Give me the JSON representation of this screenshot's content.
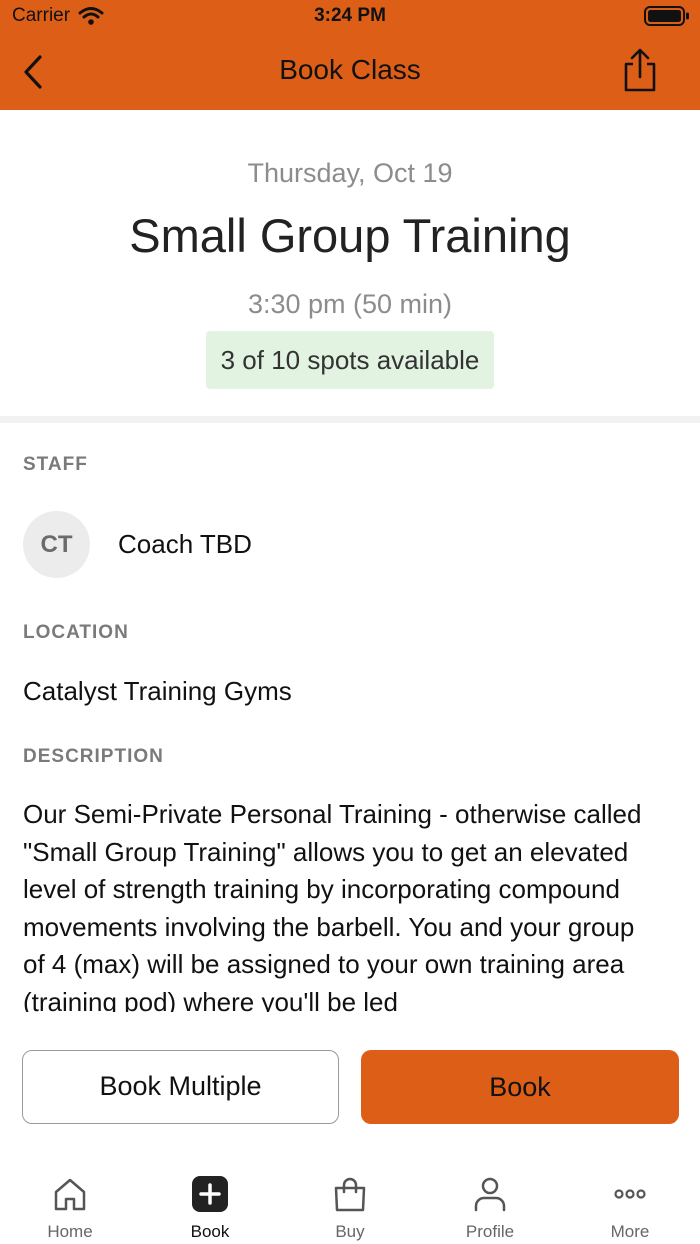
{
  "status_bar": {
    "carrier": "Carrier",
    "time": "3:24 PM"
  },
  "nav": {
    "title": "Book Class"
  },
  "class": {
    "date": "Thursday, Oct 19",
    "title": "Small Group Training",
    "time_duration": "3:30 pm (50 min)",
    "spots": "3 of 10 spots available"
  },
  "staff": {
    "label": "STAFF",
    "initials": "CT",
    "name": "Coach TBD"
  },
  "location": {
    "label": "LOCATION",
    "value": "Catalyst Training Gyms"
  },
  "description": {
    "label": "DESCRIPTION",
    "text": "Our Semi-Private Personal Training - otherwise called \"Small Group Training\" allows you to get an elevated level of strength training by incorporating compound movements involving the barbell. You and your group of 4 (max) will be assigned to your own training area (training pod) where you'll be led"
  },
  "actions": {
    "book_multiple": "Book Multiple",
    "book": "Book"
  },
  "tabs": [
    {
      "label": "Home",
      "icon": "home-icon"
    },
    {
      "label": "Book",
      "icon": "plus-square-icon"
    },
    {
      "label": "Buy",
      "icon": "shopping-bag-icon"
    },
    {
      "label": "Profile",
      "icon": "person-icon"
    },
    {
      "label": "More",
      "icon": "more-dots-icon"
    }
  ],
  "colors": {
    "accent": "#dd5f17",
    "spots_bg": "#e3f3e1"
  }
}
